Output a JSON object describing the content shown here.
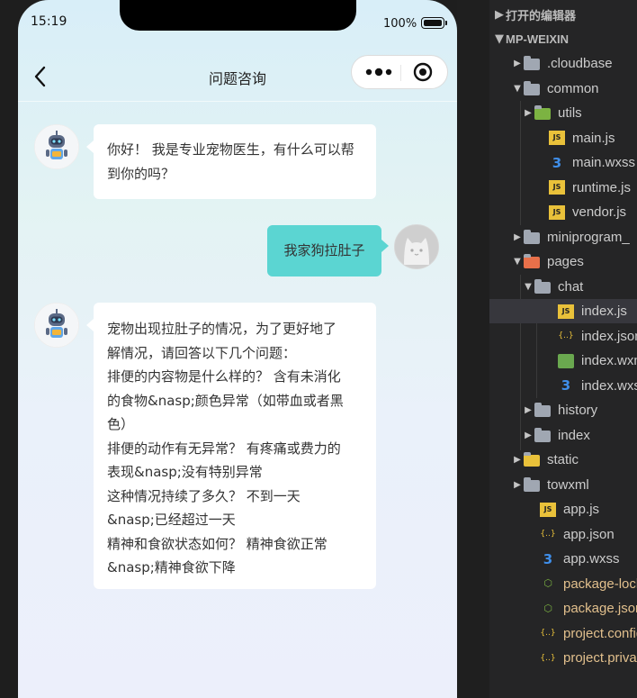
{
  "status_bar": {
    "time": "15:19",
    "battery": "100%"
  },
  "nav": {
    "title": "问题咨询",
    "back_icon": "chevron-left-icon",
    "more_icon": "more-dots-icon",
    "close_icon": "target-circle-icon"
  },
  "messages": [
    {
      "role": "bot",
      "avatar_icon": "robot-icon",
      "text": "你好！ 我是专业宠物医生，有什么可以帮到你的吗？"
    },
    {
      "role": "user",
      "avatar_icon": "cat-avatar-icon",
      "text": "我家狗拉肚子"
    },
    {
      "role": "bot",
      "avatar_icon": "robot-icon",
      "lines": [
        "宠物出现拉肚子的情况，为了更好地了",
        "解情况，请回答以下几个问题：",
        "排便的内容物是什么样的？ 含有未消化",
        "的食物&nasp;颜色异常（如带血或者黑",
        "色）",
        "排便的动作有无异常？ 有疼痛或费力的",
        "表现&nasp;没有特别异常",
        "这种情况持续了多久？ 不到一天",
        "&nasp;已经超过一天",
        "精神和食欲状态如何？ 精神食欲正常",
        "&nasp;精神食欲下降"
      ]
    }
  ],
  "explorer": {
    "open_editors": "打开的编辑器",
    "project": "MP-WEIXIN",
    "items": [
      {
        "label": ".cloudbase",
        "kind": "folder",
        "icon": "folder-icon"
      },
      {
        "label": "common",
        "kind": "folder",
        "icon": "folder-open-icon"
      },
      {
        "label": "utils",
        "kind": "folder",
        "icon": "folder-utils-icon"
      },
      {
        "label": "main.js",
        "kind": "js",
        "icon": "js-file-icon"
      },
      {
        "label": "main.wxss",
        "kind": "css",
        "icon": "css-file-icon"
      },
      {
        "label": "runtime.js",
        "kind": "js",
        "icon": "js-file-icon"
      },
      {
        "label": "vendor.js",
        "kind": "js",
        "icon": "js-file-icon"
      },
      {
        "label": "miniprogram_",
        "kind": "folder",
        "icon": "folder-icon"
      },
      {
        "label": "pages",
        "kind": "folder",
        "icon": "folder-pages-icon"
      },
      {
        "label": "chat",
        "kind": "folder",
        "icon": "folder-open-icon"
      },
      {
        "label": "index.js",
        "kind": "js",
        "icon": "js-file-icon"
      },
      {
        "label": "index.json",
        "kind": "json",
        "icon": "json-file-icon"
      },
      {
        "label": "index.wxm",
        "kind": "wxml",
        "icon": "wxml-file-icon"
      },
      {
        "label": "index.wxss",
        "kind": "css",
        "icon": "css-file-icon"
      },
      {
        "label": "history",
        "kind": "folder",
        "icon": "folder-icon"
      },
      {
        "label": "index",
        "kind": "folder",
        "icon": "folder-icon"
      },
      {
        "label": "static",
        "kind": "folder",
        "icon": "folder-static-icon"
      },
      {
        "label": "towxml",
        "kind": "folder",
        "icon": "folder-icon"
      },
      {
        "label": "app.js",
        "kind": "js",
        "icon": "js-file-icon"
      },
      {
        "label": "app.json",
        "kind": "json",
        "icon": "json-file-icon"
      },
      {
        "label": "app.wxss",
        "kind": "css",
        "icon": "css-file-icon"
      },
      {
        "label": "package-lock",
        "kind": "node",
        "icon": "node-file-icon"
      },
      {
        "label": "package.json",
        "kind": "node",
        "icon": "node-file-icon"
      },
      {
        "label": "project.config",
        "kind": "json",
        "icon": "json-file-icon"
      },
      {
        "label": "project.privat",
        "kind": "json",
        "icon": "json-file-icon"
      }
    ]
  },
  "colors": {
    "user_bubble": "#5bd5d2",
    "selected_row": "#37373d",
    "js_icon": "#e9c13a",
    "css_icon": "#3f8ee9"
  }
}
